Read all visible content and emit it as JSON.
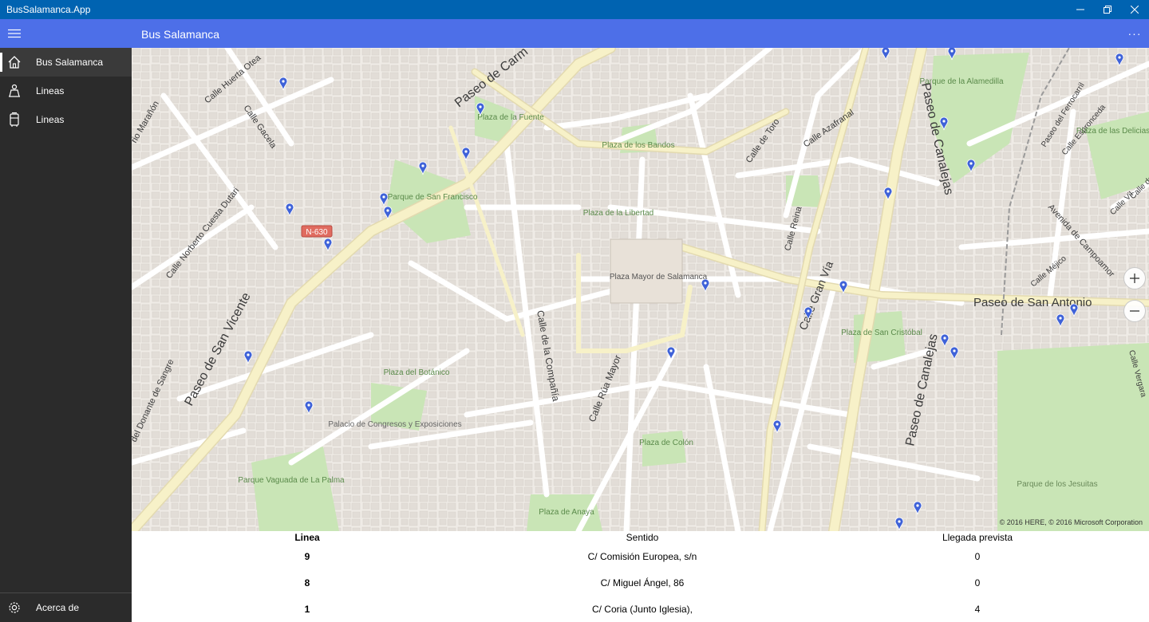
{
  "window": {
    "title": "BusSalamanca.App"
  },
  "header": {
    "title": "Bus Salamanca"
  },
  "sidebar": {
    "items": [
      {
        "label": "Bus Salamanca",
        "icon": "home-icon"
      },
      {
        "label": "Lineas",
        "icon": "person-icon"
      },
      {
        "label": "Lineas",
        "icon": "bus-icon"
      }
    ],
    "footer": {
      "label": "Acerca de",
      "icon": "gear-icon"
    }
  },
  "map": {
    "copyright": "© 2016 HERE, © 2016 Microsoft Corporation",
    "road_badge": "N-630",
    "labels": {
      "paseo_carmelitas": "Paseo de Carm",
      "paseo_canalejas_n": "Paseo de Canalejas",
      "paseo_canalejas_s": "Paseo de Canalejas",
      "paseo_san_vicente": "Paseo de San Vicente",
      "paseo_san_antonio": "Paseo de San Antonio",
      "calle_gran_via": "Calle Gran Vía",
      "calle_rua_mayor": "Calle Rúa Mayor",
      "calle_compania": "Calle de la Compañía",
      "calle_reina": "Calle Reina",
      "calle_toro": "Calle de Toro",
      "calle_azafranal": "Calle Azafranal",
      "calle_huerta_otea": "Calle Huerta Otea",
      "calle_gacela": "Calle Gacela",
      "calle_maranon": "rio Marañón",
      "calle_norberto": "Calle Norberto Cuesta Dutari",
      "calle_donante": "del Donante de Sangre",
      "paseo_ferrocarril": "Paseo del Ferrocarril",
      "calle_espronceda": "Calle Espronceda",
      "avenida_campoamor": "Avenida de Campoamor",
      "calle_mejico": "Calle Méjico",
      "calle_vergara": "Calle Vergara",
      "calle_vil": "Calle Vil",
      "calle_del": "Calle del",
      "plaza_fuente": "Plaza de la Fuente",
      "plaza_bandos": "Plaza de los Bandos",
      "parque_san_francisco": "Parque de San Francisco",
      "plaza_libertad": "Plaza de la Libertad",
      "plaza_mayor": "Plaza Mayor de Salamanca",
      "plaza_botanico": "Plaza del Botánico",
      "palacio_congresos": "Palacio de Congresos y Exposiciones",
      "parque_vaguada": "Parque Vaguada de La Palma",
      "plaza_anaya": "Plaza de Anaya",
      "plaza_colon": "Plaza de Colón",
      "plaza_san_cristobal": "Plaza de San Cristóbal",
      "parque_alamedilla": "Parque de la Alamedilla",
      "plaza_delicias": "Plaza de las Delicias",
      "parque_jesuitas": "Parque de los Jesuitas"
    }
  },
  "table": {
    "headers": [
      "Linea",
      "Sentido",
      "Llegada prevista"
    ],
    "rows": [
      {
        "linea": "9",
        "sentido": "C/ Comisión Europea, s/n",
        "llegada": "0"
      },
      {
        "linea": "8",
        "sentido": "C/ Miguel Ángel, 86",
        "llegada": "0"
      },
      {
        "linea": "1",
        "sentido": "C/ Coria (Junto Iglesia),",
        "llegada": "4"
      }
    ]
  },
  "colors": {
    "titlebar": "#0063b1",
    "header": "#4d6fe8",
    "sidebar": "#2b2b2b",
    "pin": "#3f62d8",
    "park": "#c9e5b6",
    "major_road": "#f7f1c8"
  }
}
